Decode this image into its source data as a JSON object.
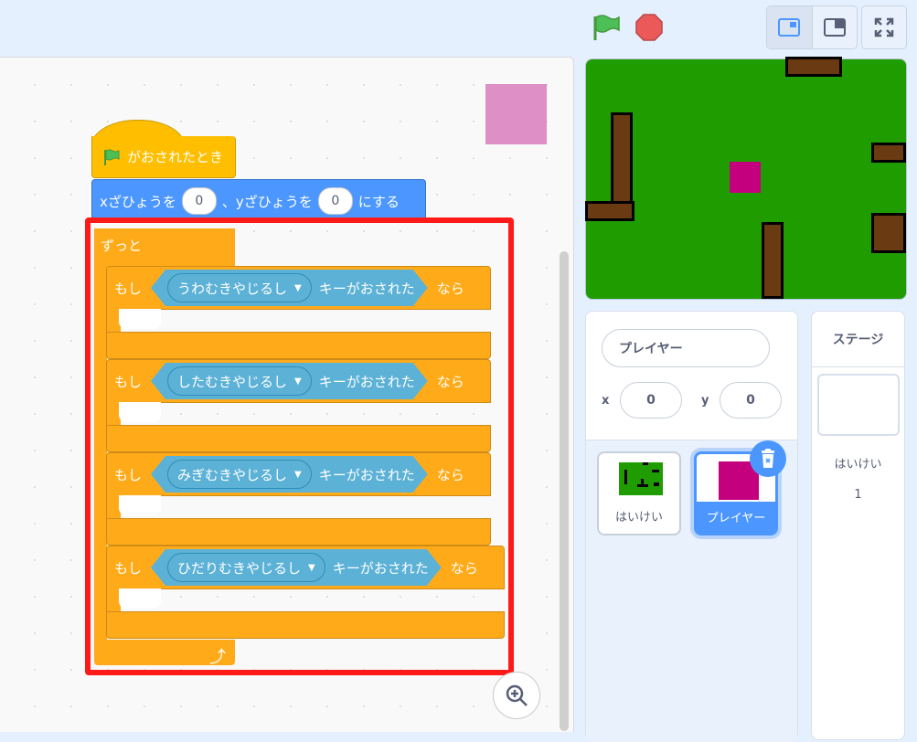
{
  "hat_block": {
    "label": "がおされたとき"
  },
  "motion_block": {
    "text_x": "xざひょうを",
    "x_value": "0",
    "text_y": "、yざひょうを",
    "y_value": "0",
    "text_end": "にする"
  },
  "forever_block": {
    "label": "ずっと",
    "loop_arrow": "⤴"
  },
  "if_blocks": [
    {
      "if_label": "もし",
      "key": "うわむきやじるし",
      "pressed": "キーがおされた",
      "then_label": "なら"
    },
    {
      "if_label": "もし",
      "key": "したむきやじるし",
      "pressed": "キーがおされた",
      "then_label": "なら"
    },
    {
      "if_label": "もし",
      "key": "みぎむきやじるし",
      "pressed": "キーがおされた",
      "then_label": "なら"
    },
    {
      "if_label": "もし",
      "key": "ひだりむきやじるし",
      "pressed": "キーがおされた",
      "then_label": "なら"
    }
  ],
  "sprite_info": {
    "name": "プレイヤー",
    "x_label": "x",
    "x_value": "0",
    "y_label": "y",
    "y_value": "0"
  },
  "sprites": [
    {
      "label": "はいけい"
    },
    {
      "label": "プレイヤー"
    }
  ],
  "stage_pane": {
    "title": "ステージ",
    "backdrop_label": "はいけい",
    "backdrop_count": "1"
  },
  "colors": {
    "events": "#ffbf00",
    "motion": "#4c97ff",
    "control": "#ffab19",
    "sensing": "#5cb1d6",
    "highlight": "#ff1a1a",
    "stage_green": "#1f9d00",
    "player": "#c4007e"
  }
}
